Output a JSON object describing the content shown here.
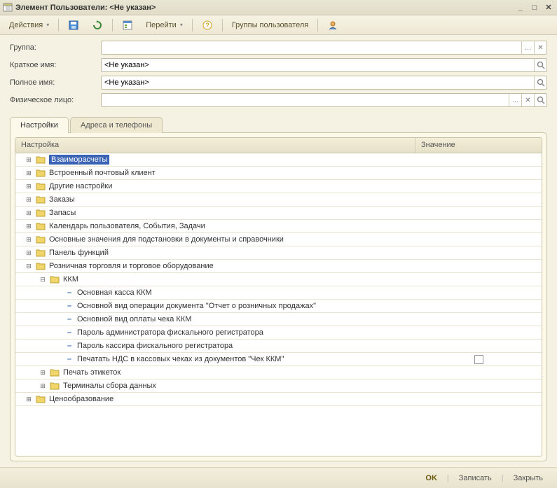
{
  "window": {
    "title": "Элемент Пользователи: <Не указан>"
  },
  "toolbar": {
    "actions": "Действия",
    "goto": "Перейти",
    "groups": "Группы пользователя"
  },
  "form": {
    "group_label": "Группа:",
    "group_value": "",
    "short_label": "Краткое имя:",
    "short_value": "<Не указан>",
    "full_label": "Полное имя:",
    "full_value": "<Не указан>",
    "person_label": "Физическое лицо:",
    "person_value": ""
  },
  "tabs": {
    "settings": "Настройки",
    "addresses": "Адреса и телефоны"
  },
  "table": {
    "col_name": "Настройка",
    "col_value": "Значение"
  },
  "tree": [
    {
      "indent": 0,
      "expand": "plus",
      "type": "folder",
      "label": "Взаиморасчеты",
      "selected": true
    },
    {
      "indent": 0,
      "expand": "plus",
      "type": "folder",
      "label": "Встроенный почтовый клиент"
    },
    {
      "indent": 0,
      "expand": "plus",
      "type": "folder",
      "label": "Другие настройки"
    },
    {
      "indent": 0,
      "expand": "plus",
      "type": "folder",
      "label": "Заказы"
    },
    {
      "indent": 0,
      "expand": "plus",
      "type": "folder",
      "label": "Запасы"
    },
    {
      "indent": 0,
      "expand": "plus",
      "type": "folder",
      "label": "Календарь пользователя, События, Задачи"
    },
    {
      "indent": 0,
      "expand": "plus",
      "type": "folder",
      "label": "Основные значения для подстановки в документы и справочники"
    },
    {
      "indent": 0,
      "expand": "plus",
      "type": "folder",
      "label": "Панель функций"
    },
    {
      "indent": 0,
      "expand": "minus",
      "type": "folder",
      "label": "Розничная торговля и торговое оборудование"
    },
    {
      "indent": 1,
      "expand": "minus",
      "type": "folder",
      "label": "ККМ"
    },
    {
      "indent": 2,
      "expand": "none",
      "type": "leaf",
      "label": "Основная касса ККМ"
    },
    {
      "indent": 2,
      "expand": "none",
      "type": "leaf",
      "label": "Основной вид операции документа \"Отчет о розничных продажах\""
    },
    {
      "indent": 2,
      "expand": "none",
      "type": "leaf",
      "label": "Основной вид оплаты чека ККМ"
    },
    {
      "indent": 2,
      "expand": "none",
      "type": "leaf",
      "label": "Пароль администратора фискального регистратора"
    },
    {
      "indent": 2,
      "expand": "none",
      "type": "leaf",
      "label": "Пароль кассира фискального регистратора"
    },
    {
      "indent": 2,
      "expand": "none",
      "type": "leaf",
      "label": "Печатать НДС в кассовых чеках из документов \"Чек ККМ\"",
      "value": "checkbox"
    },
    {
      "indent": 1,
      "expand": "plus",
      "type": "folder",
      "label": "Печать этикеток"
    },
    {
      "indent": 1,
      "expand": "plus",
      "type": "folder",
      "label": "Терминалы сбора данных"
    },
    {
      "indent": 0,
      "expand": "plus",
      "type": "folder",
      "label": "Ценообразование"
    }
  ],
  "footer": {
    "ok": "OK",
    "save": "Записать",
    "close": "Закрыть"
  }
}
